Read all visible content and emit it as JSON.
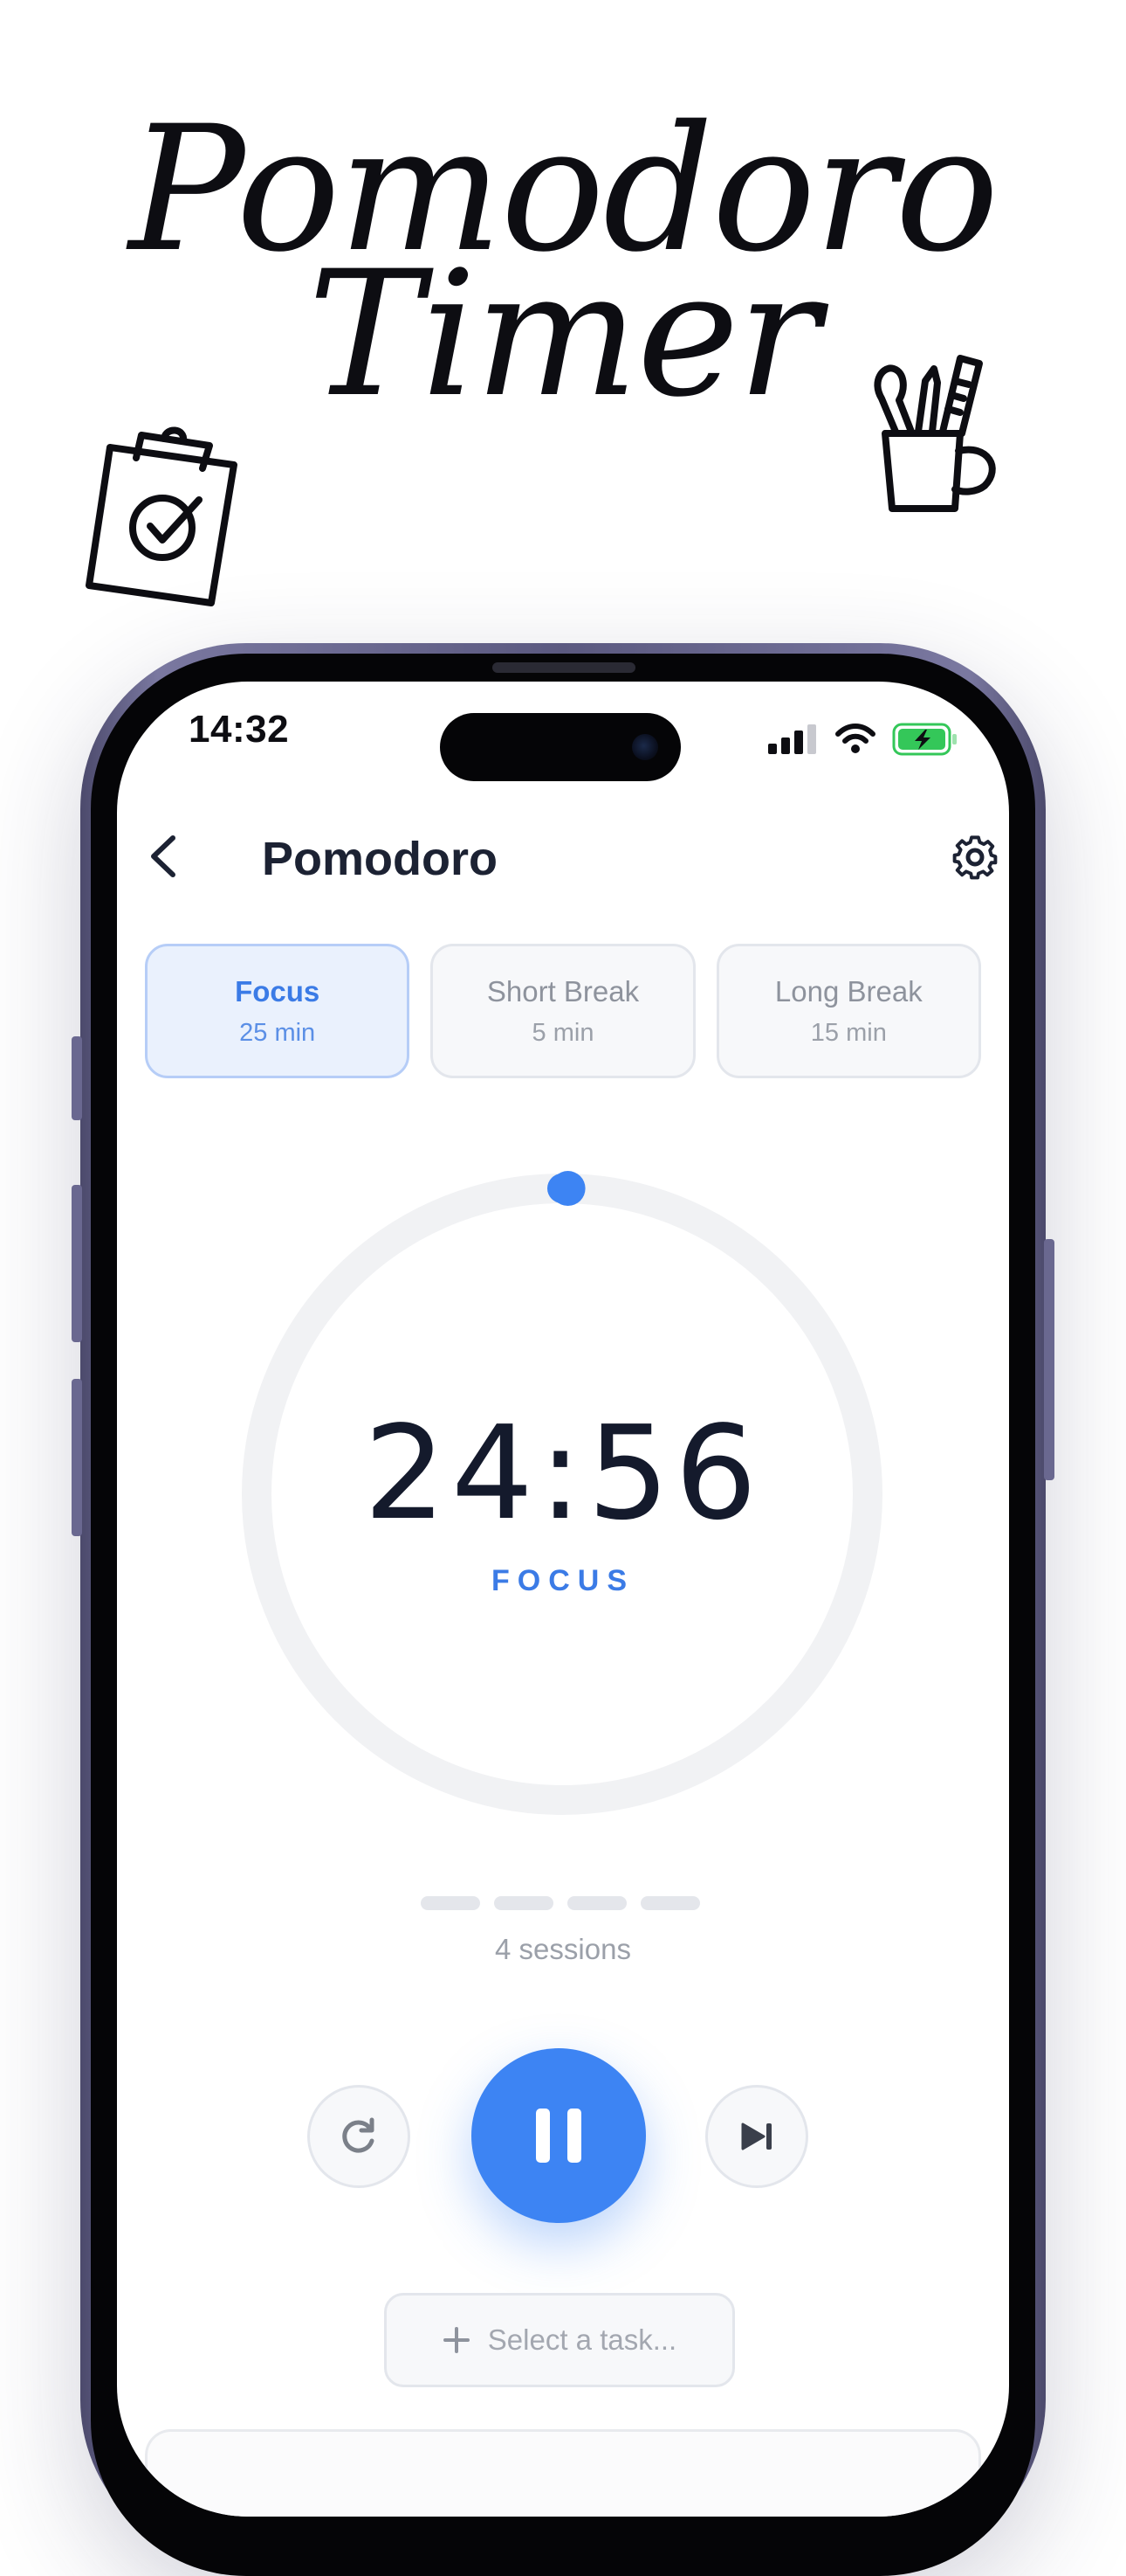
{
  "promo": {
    "title_line1": "Pomodoro",
    "title_line2": "Timer"
  },
  "doodles": {
    "left": "clipboard-check-icon",
    "right": "pencil-cup-icon"
  },
  "status_bar": {
    "time": "14:32",
    "icons": [
      "cellular-signal-icon",
      "wifi-icon",
      "battery-charging-icon"
    ]
  },
  "nav": {
    "title": "Pomodoro",
    "back_icon": "chevron-left-icon",
    "settings_icon": "gear-icon"
  },
  "modes": [
    {
      "label": "Focus",
      "duration": "25 min",
      "active": true
    },
    {
      "label": "Short Break",
      "duration": "5 min",
      "active": false
    },
    {
      "label": "Long Break",
      "duration": "15 min",
      "active": false
    }
  ],
  "timer": {
    "value": "24:56",
    "mode_label": "FOCUS",
    "progress_fraction": 0.003
  },
  "sessions": {
    "total": 4,
    "completed": 0,
    "label": "4 sessions"
  },
  "controls": {
    "reset_icon": "refresh-icon",
    "play_icon": "pause-icon",
    "skip_icon": "skip-forward-icon"
  },
  "task": {
    "icon": "plus-icon",
    "placeholder": "Select a task..."
  },
  "colors": {
    "accent": "#3d84f3",
    "accent_text": "#3b7be6",
    "text_primary": "#141a2c",
    "text_muted": "#9ba0a9",
    "battery_green": "#34c759"
  }
}
